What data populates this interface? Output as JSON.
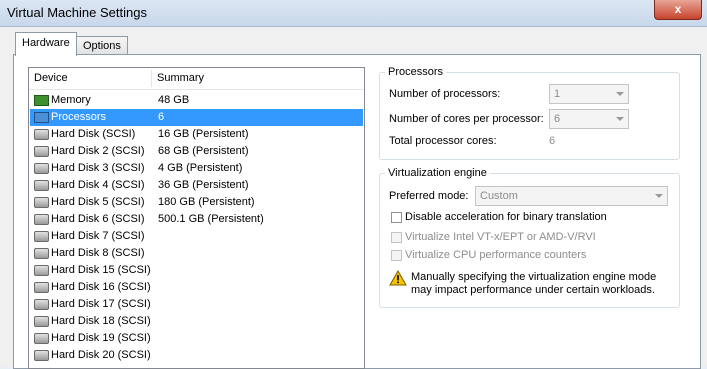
{
  "window": {
    "title": "Virtual Machine Settings",
    "close": "x"
  },
  "tabs": [
    {
      "label": "Hardware"
    },
    {
      "label": "Options"
    }
  ],
  "device_list": {
    "columns": {
      "device": "Device",
      "summary": "Summary"
    },
    "rows": [
      {
        "device": "Memory",
        "summary": "48 GB",
        "icon": "memory-icon"
      },
      {
        "device": "Processors",
        "summary": "6",
        "icon": "processor-icon",
        "selected": true
      },
      {
        "device": "Hard Disk (SCSI)",
        "summary": "16 GB (Persistent)",
        "icon": "hard-disk-icon"
      },
      {
        "device": "Hard Disk 2 (SCSI)",
        "summary": "68 GB (Persistent)",
        "icon": "hard-disk-icon"
      },
      {
        "device": "Hard Disk 3 (SCSI)",
        "summary": "4 GB (Persistent)",
        "icon": "hard-disk-icon"
      },
      {
        "device": "Hard Disk 4 (SCSI)",
        "summary": "36 GB (Persistent)",
        "icon": "hard-disk-icon"
      },
      {
        "device": "Hard Disk 5 (SCSI)",
        "summary": "180 GB (Persistent)",
        "icon": "hard-disk-icon"
      },
      {
        "device": "Hard Disk 6 (SCSI)",
        "summary": "500.1 GB (Persistent)",
        "icon": "hard-disk-icon"
      },
      {
        "device": "Hard Disk 7 (SCSI)",
        "summary": "",
        "icon": "hard-disk-icon"
      },
      {
        "device": "Hard Disk 8 (SCSI)",
        "summary": "",
        "icon": "hard-disk-icon"
      },
      {
        "device": "Hard Disk 15 (SCSI)",
        "summary": "",
        "icon": "hard-disk-icon"
      },
      {
        "device": "Hard Disk 16 (SCSI)",
        "summary": "",
        "icon": "hard-disk-icon"
      },
      {
        "device": "Hard Disk 17 (SCSI)",
        "summary": "",
        "icon": "hard-disk-icon"
      },
      {
        "device": "Hard Disk 18 (SCSI)",
        "summary": "",
        "icon": "hard-disk-icon"
      },
      {
        "device": "Hard Disk 19 (SCSI)",
        "summary": "",
        "icon": "hard-disk-icon"
      },
      {
        "device": "Hard Disk 20 (SCSI)",
        "summary": "",
        "icon": "hard-disk-icon"
      }
    ]
  },
  "processors": {
    "title": "Processors",
    "num_processors_label": "Number of processors:",
    "num_processors_value": "1",
    "cores_label": "Number of cores per processor:",
    "cores_value": "6",
    "total_label": "Total processor cores:",
    "total_value": "6"
  },
  "virtualization": {
    "title": "Virtualization engine",
    "mode_label": "Preferred mode:",
    "mode_value": "Custom",
    "disable_accel": "Disable acceleration for binary translation",
    "vtx": "Virtualize Intel VT-x/EPT or AMD-V/RVI",
    "perf_counters": "Virtualize CPU performance counters",
    "warning_line1": "Manually specifying the virtualization engine mode",
    "warning_line2": "may impact performance under certain workloads."
  }
}
